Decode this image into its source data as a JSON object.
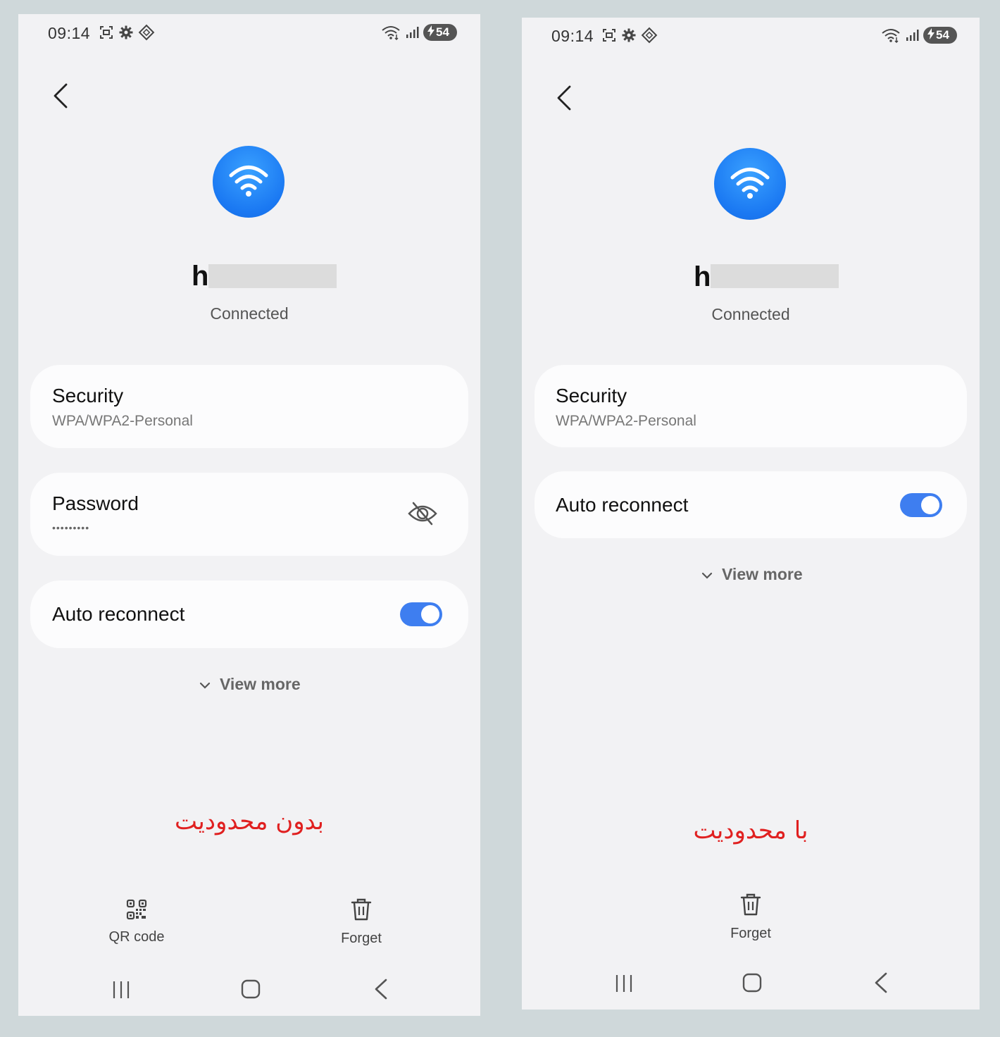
{
  "screens": [
    {
      "status_bar": {
        "time": "09:14",
        "battery": "54"
      },
      "network": {
        "name_visible": "h",
        "status": "Connected"
      },
      "security": {
        "label": "Security",
        "value": "WPA/WPA2-Personal"
      },
      "password": {
        "label": "Password",
        "value": "•••••••••"
      },
      "auto_reconnect": {
        "label": "Auto reconnect",
        "enabled": true
      },
      "view_more": "View more",
      "annotation": "بدون محدودیت",
      "actions": {
        "qr": "QR code",
        "forget": "Forget"
      }
    },
    {
      "status_bar": {
        "time": "09:14",
        "battery": "54"
      },
      "network": {
        "name_visible": "h",
        "status": "Connected"
      },
      "security": {
        "label": "Security",
        "value": "WPA/WPA2-Personal"
      },
      "auto_reconnect": {
        "label": "Auto reconnect",
        "enabled": true
      },
      "view_more": "View more",
      "annotation": "با محدودیت",
      "actions": {
        "forget": "Forget"
      }
    }
  ],
  "colors": {
    "accent": "#3e7ef0",
    "wifi_icon": "#1a78f2",
    "annotation": "#e02020",
    "screen_bg": "#f2f2f4",
    "outer_bg": "#cfd8da"
  },
  "icons": [
    "back-chevron-icon",
    "wifi-icon",
    "eye-off-icon",
    "qr-code-icon",
    "trash-icon",
    "chevron-down-icon",
    "recent-apps-icon",
    "home-icon",
    "nav-back-icon"
  ]
}
